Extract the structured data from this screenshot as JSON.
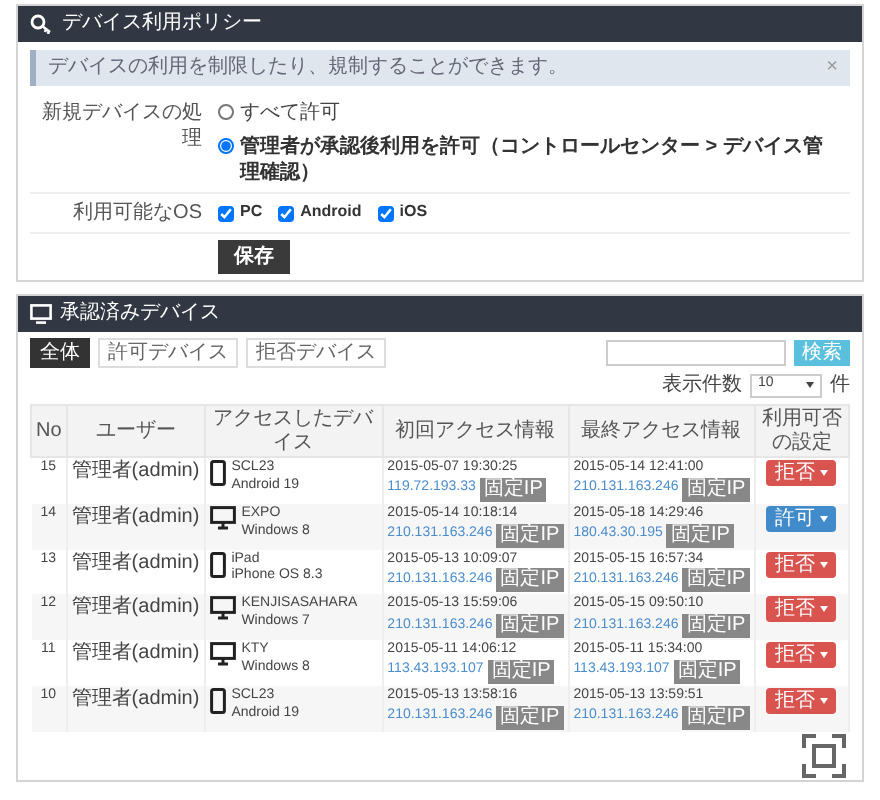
{
  "policy_panel": {
    "title": "デバイス利用ポリシー",
    "alert": {
      "text": "デバイスの利用を制限したり、規制することができます。",
      "close": "×"
    },
    "new_device": {
      "label": "新規デバイスの処理",
      "options": [
        {
          "label": "すべて許可",
          "selected": false
        },
        {
          "label": "管理者が承認後利用を許可（コントロールセンター > デバイス管理確認）",
          "selected": true
        }
      ]
    },
    "allowed_os": {
      "label": "利用可能なOS",
      "options": [
        {
          "label": "PC",
          "checked": true
        },
        {
          "label": "Android",
          "checked": true
        },
        {
          "label": "iOS",
          "checked": true
        }
      ]
    },
    "save_button": "保存"
  },
  "devices_panel": {
    "title": "承認済みデバイス",
    "tabs": [
      {
        "label": "全体",
        "selected": true
      },
      {
        "label": "許可デバイス",
        "selected": false
      },
      {
        "label": "拒否デバイス",
        "selected": false
      }
    ],
    "search": {
      "button": "検索"
    },
    "page_size": {
      "label": "表示件数",
      "value": "10",
      "unit": "件"
    },
    "columns": [
      "No",
      "ユーザー",
      "アクセスしたデバイス",
      "初回アクセス情報",
      "最終アクセス情報",
      "利用可否の設定"
    ],
    "rows": [
      {
        "no": "15",
        "user": "管理者(admin)",
        "kind": "phone",
        "device_name": "SCL23",
        "os": "Android 19",
        "first_access": "2015-05-07 19:30:25",
        "first_ip": "119.72.193.33",
        "first_badge": "固定IP",
        "last_access": "2015-05-14 12:41:00",
        "last_ip": "210.131.163.246",
        "last_badge": "固定IP",
        "action": {
          "label": "拒否",
          "kind": "deny"
        }
      },
      {
        "no": "14",
        "user": "管理者(admin)",
        "kind": "monitor",
        "device_name": "EXPO",
        "os": "Windows 8",
        "first_access": "2015-05-14 10:18:14",
        "first_ip": "210.131.163.246",
        "first_badge": "固定IP",
        "last_access": "2015-05-18 14:29:46",
        "last_ip": "180.43.30.195",
        "last_badge": "固定IP",
        "action": {
          "label": "許可",
          "kind": "allow"
        }
      },
      {
        "no": "13",
        "user": "管理者(admin)",
        "kind": "phone",
        "device_name": "iPad",
        "os": "iPhone OS 8.3",
        "first_access": "2015-05-13 10:09:07",
        "first_ip": "210.131.163.246",
        "first_badge": "固定IP",
        "last_access": "2015-05-15 16:57:34",
        "last_ip": "210.131.163.246",
        "last_badge": "固定IP",
        "action": {
          "label": "拒否",
          "kind": "deny"
        }
      },
      {
        "no": "12",
        "user": "管理者(admin)",
        "kind": "monitor",
        "device_name": "KENJISASAHARA",
        "os": "Windows 7",
        "first_access": "2015-05-13 15:59:06",
        "first_ip": "210.131.163.246",
        "first_badge": "固定IP",
        "last_access": "2015-05-15 09:50:10",
        "last_ip": "210.131.163.246",
        "last_badge": "固定IP",
        "action": {
          "label": "拒否",
          "kind": "deny"
        }
      },
      {
        "no": "11",
        "user": "管理者(admin)",
        "kind": "monitor",
        "device_name": "KTY",
        "os": "Windows 8",
        "first_access": "2015-05-11 14:06:12",
        "first_ip": "113.43.193.107",
        "first_badge": "固定IP",
        "last_access": "2015-05-11 15:34:00",
        "last_ip": "113.43.193.107",
        "last_badge": "固定IP",
        "action": {
          "label": "拒否",
          "kind": "deny"
        }
      },
      {
        "no": "10",
        "user": "管理者(admin)",
        "kind": "phone",
        "device_name": "SCL23",
        "os": "Android 19",
        "first_access": "2015-05-13 13:58:16",
        "first_ip": "210.131.163.246",
        "first_badge": "固定IP",
        "last_access": "2015-05-13 13:59:51",
        "last_ip": "210.131.163.246",
        "last_badge": "固定IP",
        "action": {
          "label": "拒否",
          "kind": "deny"
        }
      }
    ]
  }
}
